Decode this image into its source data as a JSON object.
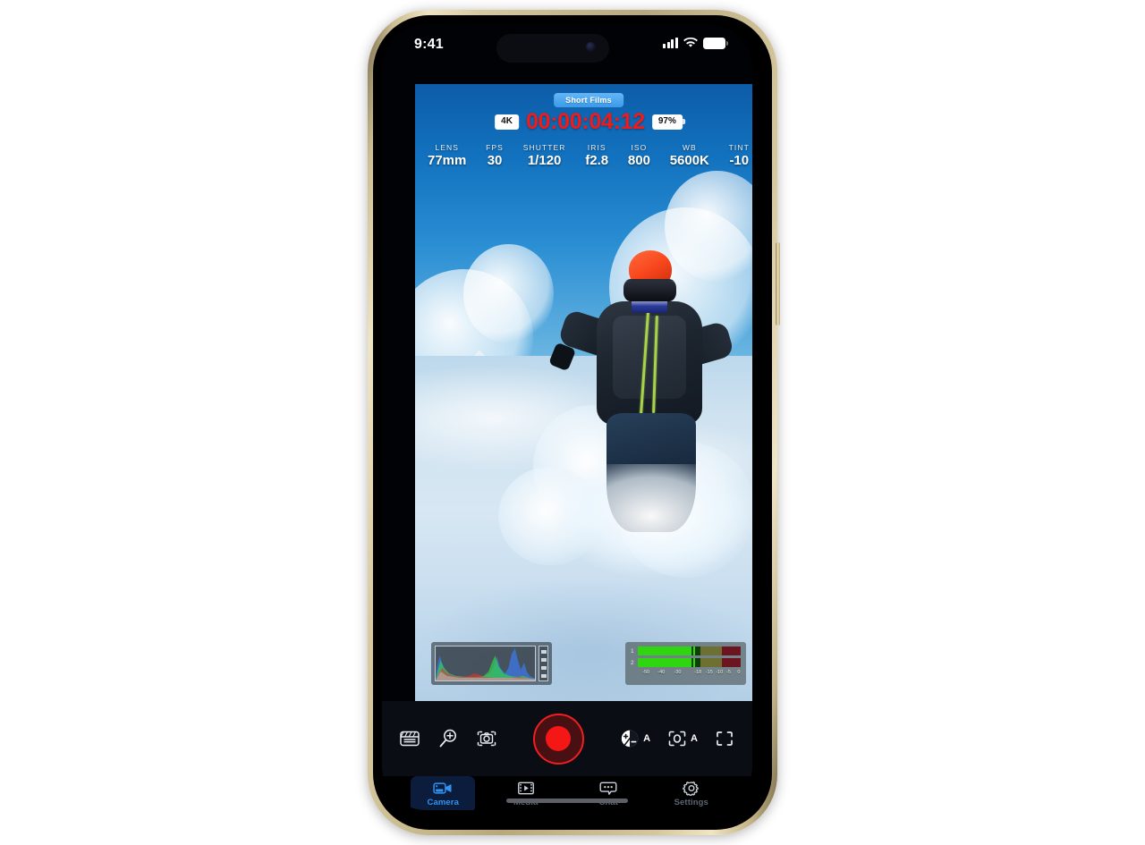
{
  "device": {
    "frame_color": "#d6c69c",
    "screen_bg": "#000205"
  },
  "status_bar": {
    "time": "9:41",
    "cellular_icon": "signal-bars-icon",
    "wifi_icon": "wifi-icon",
    "battery_icon": "battery-full-icon"
  },
  "viewfinder": {
    "project_badge": "Short Films",
    "resolution_chip": "4K",
    "timecode": "00:00:04:12",
    "battery_chip": "97%",
    "timecode_color": "#ef1b1b",
    "badge_color": "#3b9aea",
    "metadata": [
      {
        "key": "LENS",
        "value": "77mm"
      },
      {
        "key": "FPS",
        "value": "30"
      },
      {
        "key": "SHUTTER",
        "value": "1/120"
      },
      {
        "key": "IRIS",
        "value": "f2.8"
      },
      {
        "key": "ISO",
        "value": "800"
      },
      {
        "key": "WB",
        "value": "5600K"
      },
      {
        "key": "TINT",
        "value": "-10"
      }
    ],
    "scene_description": "snowboarder-in-powder"
  },
  "scopes": {
    "histogram": {
      "name": "rgb-histogram",
      "channels": [
        "red",
        "green",
        "blue",
        "luma"
      ]
    },
    "audio_meters": {
      "name": "audio-level-meters",
      "channels": [
        "1",
        "2"
      ],
      "scale_labels": [
        "-50",
        "-40",
        "-30",
        "-18",
        "-15",
        "-10",
        "-5",
        "0"
      ],
      "level_db": -18
    }
  },
  "controls": {
    "left": [
      {
        "name": "slate-button",
        "icon": "clapperboard-icon",
        "label": ""
      },
      {
        "name": "zoom-button",
        "icon": "magnifier-plus-icon",
        "label": ""
      },
      {
        "name": "frame-grab-button",
        "icon": "camera-focus-icon",
        "label": ""
      }
    ],
    "record": {
      "name": "record-button",
      "state": "recording",
      "color": "#f51616"
    },
    "right": [
      {
        "name": "exposure-button",
        "icon": "exposure-compensation-icon",
        "label": "A"
      },
      {
        "name": "focus-button",
        "icon": "focus-reticle-icon",
        "label": "A"
      },
      {
        "name": "framing-button",
        "icon": "framing-brackets-icon",
        "label": ""
      }
    ]
  },
  "tab_bar": {
    "active_index": 0,
    "active_color": "#2f94f2",
    "inactive_color": "#5b6472",
    "items": [
      {
        "label": "Camera",
        "icon": "video-camera-icon"
      },
      {
        "label": "Media",
        "icon": "film-strip-icon"
      },
      {
        "label": "Chat",
        "icon": "chat-bubble-icon"
      },
      {
        "label": "Settings",
        "icon": "gear-icon"
      }
    ]
  }
}
